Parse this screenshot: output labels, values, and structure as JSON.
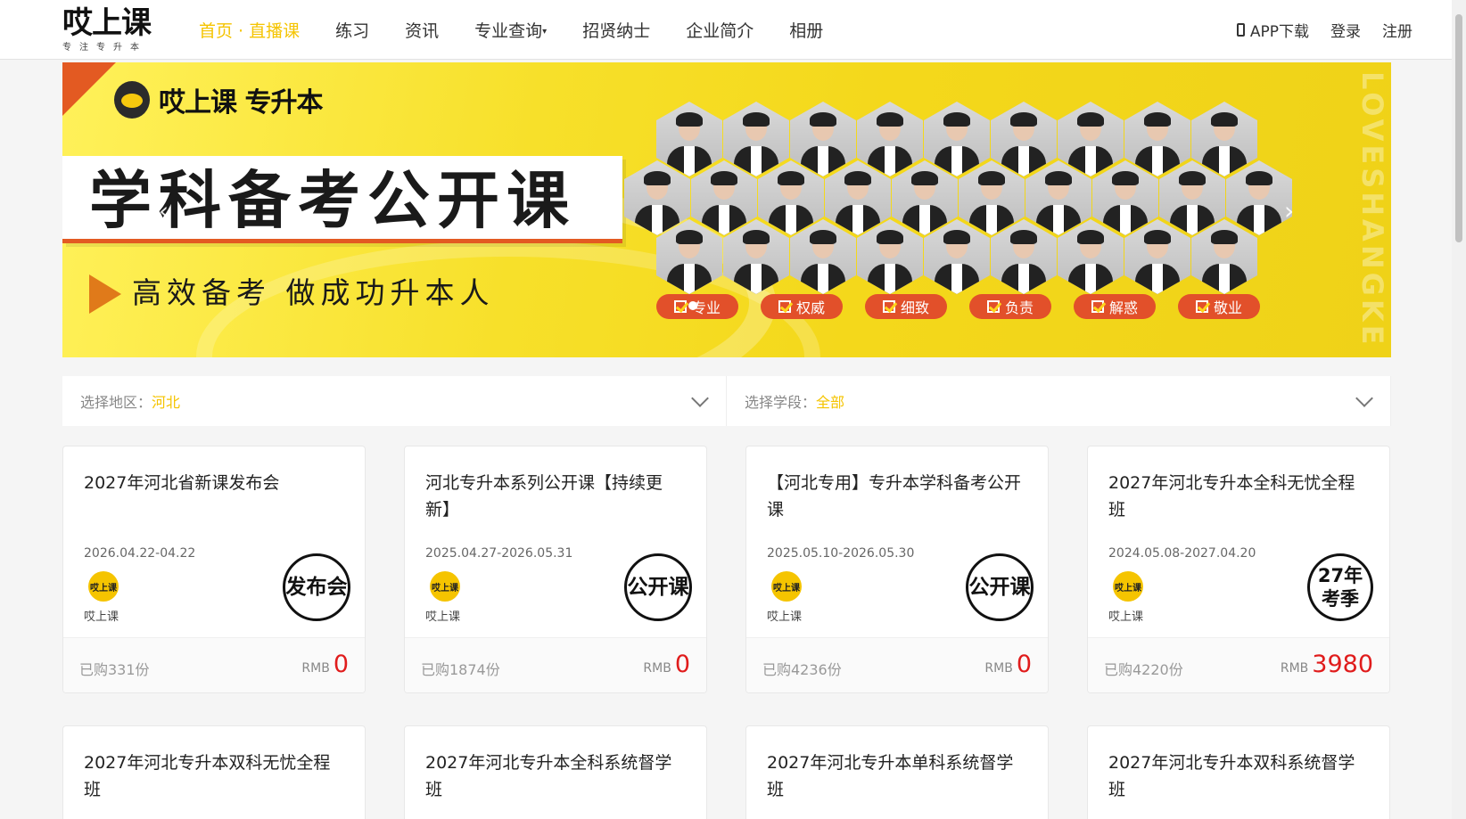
{
  "header": {
    "logo_main": "哎上课",
    "logo_sub": "专注专升本",
    "nav": [
      {
        "label": "首页 · 直播课",
        "active": true
      },
      {
        "label": "练习"
      },
      {
        "label": "资讯"
      },
      {
        "label": "专业查询"
      },
      {
        "label": "招贤纳士"
      },
      {
        "label": "企业简介"
      },
      {
        "label": "相册"
      }
    ],
    "app_download": "APP下载",
    "login": "登录",
    "register": "注册"
  },
  "banner": {
    "brand": "哎上课 专升本",
    "title": "学科备考公开课",
    "slogan": "高效备考 做成功升本人",
    "watermark": "LOVESHANGKE",
    "tags": [
      "专业",
      "权威",
      "细致",
      "负责",
      "解惑",
      "敬业"
    ]
  },
  "filters": {
    "region_label": "选择地区：",
    "region_value": "河北",
    "stage_label": "选择学段：",
    "stage_value": "全部"
  },
  "cards": [
    {
      "title": "2027年河北省新课发布会",
      "date": "2026.04.22-04.22",
      "teacher": "哎上课",
      "avatar_text": "哎上课",
      "stamp": "发布会",
      "bought": "已购331份",
      "rmb": "RMB",
      "price": "0"
    },
    {
      "title": "河北专升本系列公开课【持续更新】",
      "date": "2025.04.27-2026.05.31",
      "teacher": "哎上课",
      "avatar_text": "哎上课",
      "stamp": "公开课",
      "bought": "已购1874份",
      "rmb": "RMB",
      "price": "0"
    },
    {
      "title": "【河北专用】专升本学科备考公开课",
      "date": "2025.05.10-2026.05.30",
      "teacher": "哎上课",
      "avatar_text": "哎上课",
      "stamp": "公开课",
      "bought": "已购4236份",
      "rmb": "RMB",
      "price": "0"
    },
    {
      "title": "2027年河北专升本全科无忧全程班",
      "date": "2024.05.08-2027.04.20",
      "teacher": "哎上课",
      "avatar_text": "哎上课",
      "stamp": "27年 考季",
      "bought": "已购4220份",
      "rmb": "RMB",
      "price": "3980"
    },
    {
      "title": "2027年河北专升本双科无忧全程班"
    },
    {
      "title": "2027年河北专升本全科系统督学班"
    },
    {
      "title": "2027年河北专升本单科系统督学班"
    },
    {
      "title": "2027年河北专升本双科系统督学班"
    }
  ]
}
